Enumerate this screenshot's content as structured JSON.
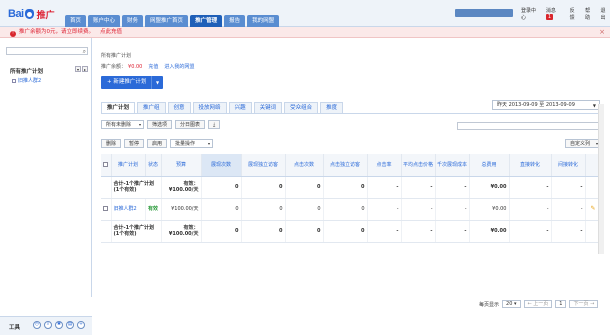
{
  "header": {
    "logo_text": "Bai",
    "logo_suffix": "推广",
    "nav": [
      "首页",
      "账户中心",
      "财务",
      "网盟推广首页",
      "推广管理",
      "报告",
      "我的网盟"
    ],
    "active_nav": 4,
    "links": {
      "logout": "登录中心",
      "message": "消息",
      "message_count": "1",
      "feedback": "反馈",
      "help": "帮助",
      "quit": "退出"
    }
  },
  "alert": {
    "text": "推广余额为0元，请立即续费。",
    "link": "点此充值"
  },
  "sidebar": {
    "title": "所有推广计划",
    "item": "旧推人群2",
    "tools_label": "工具"
  },
  "main": {
    "breadcrumb": "所有推广计划",
    "balance_label": "推广余额：",
    "balance_value": "¥0.00",
    "recharge": "充值",
    "enter_link": "进入我的网盟",
    "new_plan": "新建推广计划",
    "tabs": [
      "推广计划",
      "推广组",
      "创意",
      "投放网络",
      "兴趣",
      "关键词",
      "受众组合",
      "推度"
    ],
    "date_range": "昨天   2013-09-09 至 2013-09-09",
    "filter": {
      "select": "所有未删除",
      "filter_btn": "筛选项",
      "chart_btn": "分日图表"
    },
    "actions": {
      "delete": "删除",
      "pause": "暂停",
      "enable": "启用",
      "batch": "批量操作"
    },
    "custom_cols": "自定义列"
  },
  "table": {
    "headers": [
      "推广计划",
      "状态",
      "预算",
      "展现次数",
      "展现独立访客",
      "点击次数",
      "点击独立访客",
      "点击率",
      "平均点击价格",
      "千次展现成本",
      "总费用",
      "直接转化",
      "间接转化"
    ],
    "rows": [
      {
        "name": "合计-1个推广计划(1个有效)",
        "status": "",
        "budget": "有效：¥100.00/天",
        "impr": "0",
        "uv_impr": "0",
        "clicks": "0",
        "uv_click": "0",
        "ctr": "-",
        "cpc": "-",
        "cpm": "-",
        "cost": "¥0.00",
        "direct": "-",
        "indirect": "-",
        "total": true
      },
      {
        "name": "旧推人群2",
        "status": "有效",
        "budget": "¥100.00/天",
        "impr": "0",
        "uv_impr": "0",
        "clicks": "0",
        "uv_click": "0",
        "ctr": "-",
        "cpc": "-",
        "cpm": "-",
        "cost": "¥0.00",
        "direct": "-",
        "indirect": "-",
        "total": false
      },
      {
        "name": "合计-1个推广计划(1个有效)",
        "status": "",
        "budget": "有效：¥100.00/天",
        "impr": "0",
        "uv_impr": "0",
        "clicks": "0",
        "uv_click": "0",
        "ctr": "-",
        "cpc": "-",
        "cpm": "-",
        "cost": "¥0.00",
        "direct": "-",
        "indirect": "-",
        "total": true
      }
    ]
  },
  "pager": {
    "per_page_label": "每页显示",
    "per_page": "20",
    "prev": "上一页",
    "page": "1",
    "next": "下一页"
  }
}
